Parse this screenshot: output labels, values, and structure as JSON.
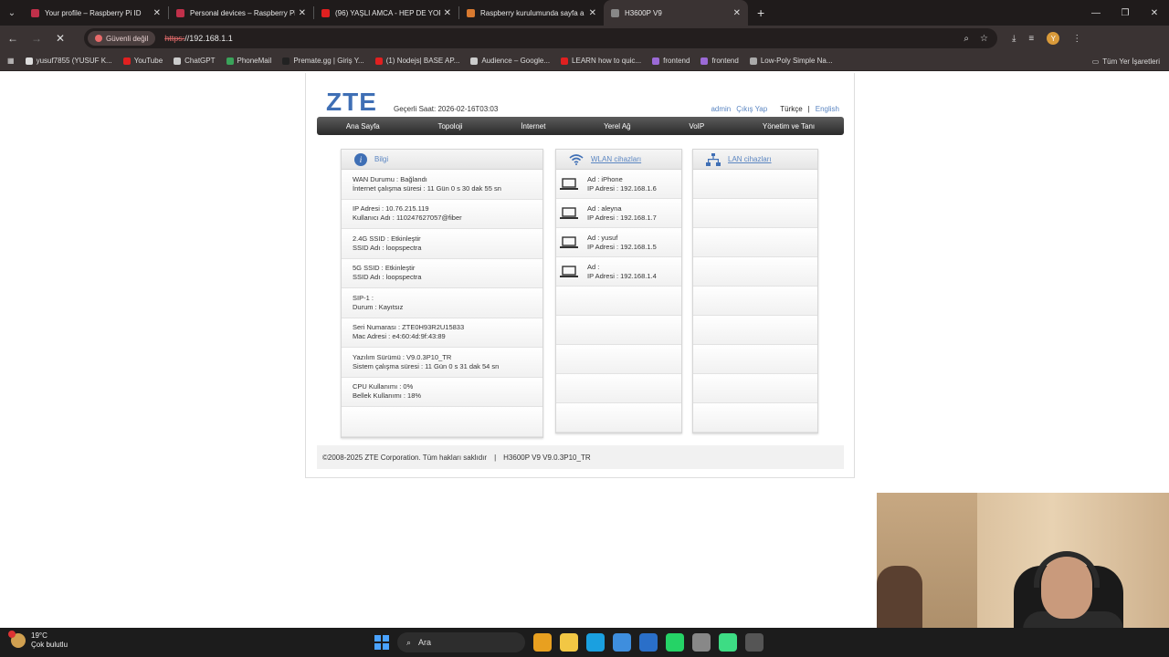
{
  "browser": {
    "tabs": [
      {
        "title": "Your profile – Raspberry Pi ID",
        "color": "#c0304a",
        "active": false
      },
      {
        "title": "Personal devices – Raspberry Pi",
        "color": "#c0304a",
        "active": false
      },
      {
        "title": "(96) YAŞLI AMCA - HEP DE YOR",
        "color": "#e02020",
        "active": false
      },
      {
        "title": "Raspberry kurulumunda sayfa a",
        "color": "#d97a30",
        "active": false
      },
      {
        "title": "H3600P V9",
        "color": "#888888",
        "active": true
      }
    ],
    "security_label": "Güvenli değil",
    "url_scheme": "https:",
    "url_rest": "//192.168.1.1",
    "profile_initial": "Y",
    "bookmarks": [
      {
        "label": "yusuf7855 (YUSUF K...",
        "color": "#dddddd"
      },
      {
        "label": "YouTube",
        "color": "#e02020"
      },
      {
        "label": "ChatGPT",
        "color": "#cccccc"
      },
      {
        "label": "PhoneMail",
        "color": "#3aa35a"
      },
      {
        "label": "Premate.gg | Giriş Y...",
        "color": "#222222"
      },
      {
        "label": "(1) Nodejs| BASE AP...",
        "color": "#e02020"
      },
      {
        "label": "Audience – Google...",
        "color": "#cccccc"
      },
      {
        "label": "LEARN how to quic...",
        "color": "#e02020"
      },
      {
        "label": "frontend",
        "color": "#9b6ad6"
      },
      {
        "label": "frontend",
        "color": "#9b6ad6"
      },
      {
        "label": "Low-Poly Simple Na...",
        "color": "#aaaaaa"
      }
    ],
    "all_bookmarks": "Tüm Yer İşaretleri"
  },
  "router": {
    "logo": "ZTE",
    "current_time": "Geçerli Saat: 2026-02-16T03:03",
    "user": "admin",
    "logout": "Çıkış Yap",
    "lang_current": "Türkçe",
    "lang_sep": "|",
    "lang_other": "English",
    "nav": [
      "Ana Sayfa",
      "Topoloji",
      "İnternet",
      "Yerel Ağ",
      "VoIP",
      "Yönetim ve Tanı"
    ],
    "info_title": "Bilgi",
    "info_rows": [
      [
        "WAN Durumu : Bağlandı",
        "İnternet çalışma süresi : 11 Gün 0 s 30 dak 55 sn"
      ],
      [
        "IP Adresi : 10.76.215.119",
        "Kullanıcı Adı : 110247627057@fiber"
      ],
      [
        "2.4G SSID : Etkinleştir",
        "SSID Adı : loopspectra"
      ],
      [
        "5G SSID : Etkinleştir",
        "SSID Adı : loopspectra"
      ],
      [
        "SIP-1 :",
        "Durum : Kayıtsız"
      ],
      [
        "Seri Numarası : ZTE0H93R2U15833",
        "Mac Adresi : e4:60:4d:9f:43:89"
      ],
      [
        "Yazılım Sürümü : V9.0.3P10_TR",
        "Sistem çalışma süresi : 11 Gün 0 s 31 dak 54 sn"
      ],
      [
        "CPU Kullanımı : 0%",
        "Bellek Kullanımı : 18%"
      ],
      [
        "",
        ""
      ]
    ],
    "wlan_title": "WLAN cihazları",
    "wlan_devices": [
      [
        "Ad : iPhone",
        "IP Adresi : 192.168.1.6"
      ],
      [
        "Ad : aleyna",
        "IP Adresi : 192.168.1.7"
      ],
      [
        "Ad : yusuf",
        "IP Adresi : 192.168.1.5"
      ],
      [
        "Ad :",
        "IP Adresi : 192.168.1.4"
      ]
    ],
    "lan_title": "LAN cihazları",
    "footer_copy": "©2008-2025 ZTE Corporation. Tüm hakları saklıdır",
    "footer_sep": "|",
    "footer_model": "H3600P V9 V9.0.3P10_TR"
  },
  "taskbar": {
    "temp": "19°C",
    "weather": "Çok bulutlu",
    "search_placeholder": "Ara",
    "apps": [
      "#e8a020",
      "#f2c744",
      "#1aa0e0",
      "#3e8ede",
      "#2a6fc9",
      "#25d366",
      "#888888",
      "#3ddc84",
      "#555555"
    ]
  }
}
